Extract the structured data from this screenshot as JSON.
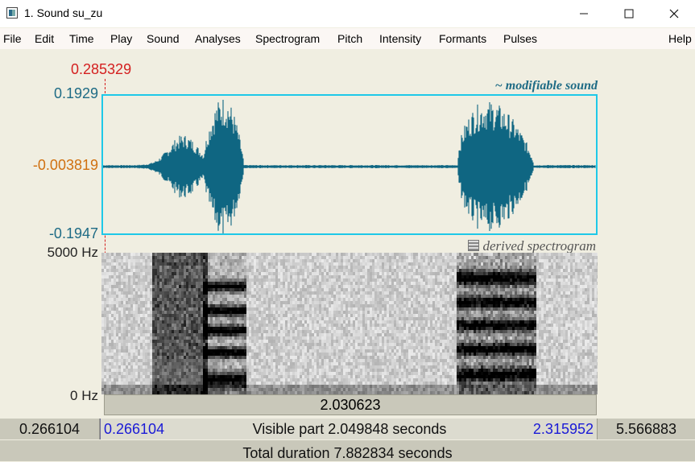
{
  "window": {
    "title": "1. Sound su_zu"
  },
  "menu": [
    "File",
    "Edit",
    "Time",
    "Play",
    "Sound",
    "Analyses",
    "Spectrogram",
    "Pitch",
    "Intensity",
    "Formants",
    "Pulses",
    "Help"
  ],
  "cursor": {
    "time": "0.285329"
  },
  "waveform": {
    "label": "~ modifiable sound",
    "y_max": "0.1929",
    "y_mid": "-0.003819",
    "y_min": "-0.1947",
    "color": "#0f6682"
  },
  "spectrogram": {
    "label": "derived spectrogram",
    "f_max": "5000 Hz",
    "f_min": "0 Hz"
  },
  "selection": {
    "duration": "2.030623"
  },
  "time_row": {
    "left_hidden": "0.266104",
    "visible_start": "0.266104",
    "visible_part": "Visible part 2.049848 seconds",
    "visible_end": "2.315952",
    "right_hidden": "5.566883"
  },
  "total": "Total duration 7.882834 seconds"
}
